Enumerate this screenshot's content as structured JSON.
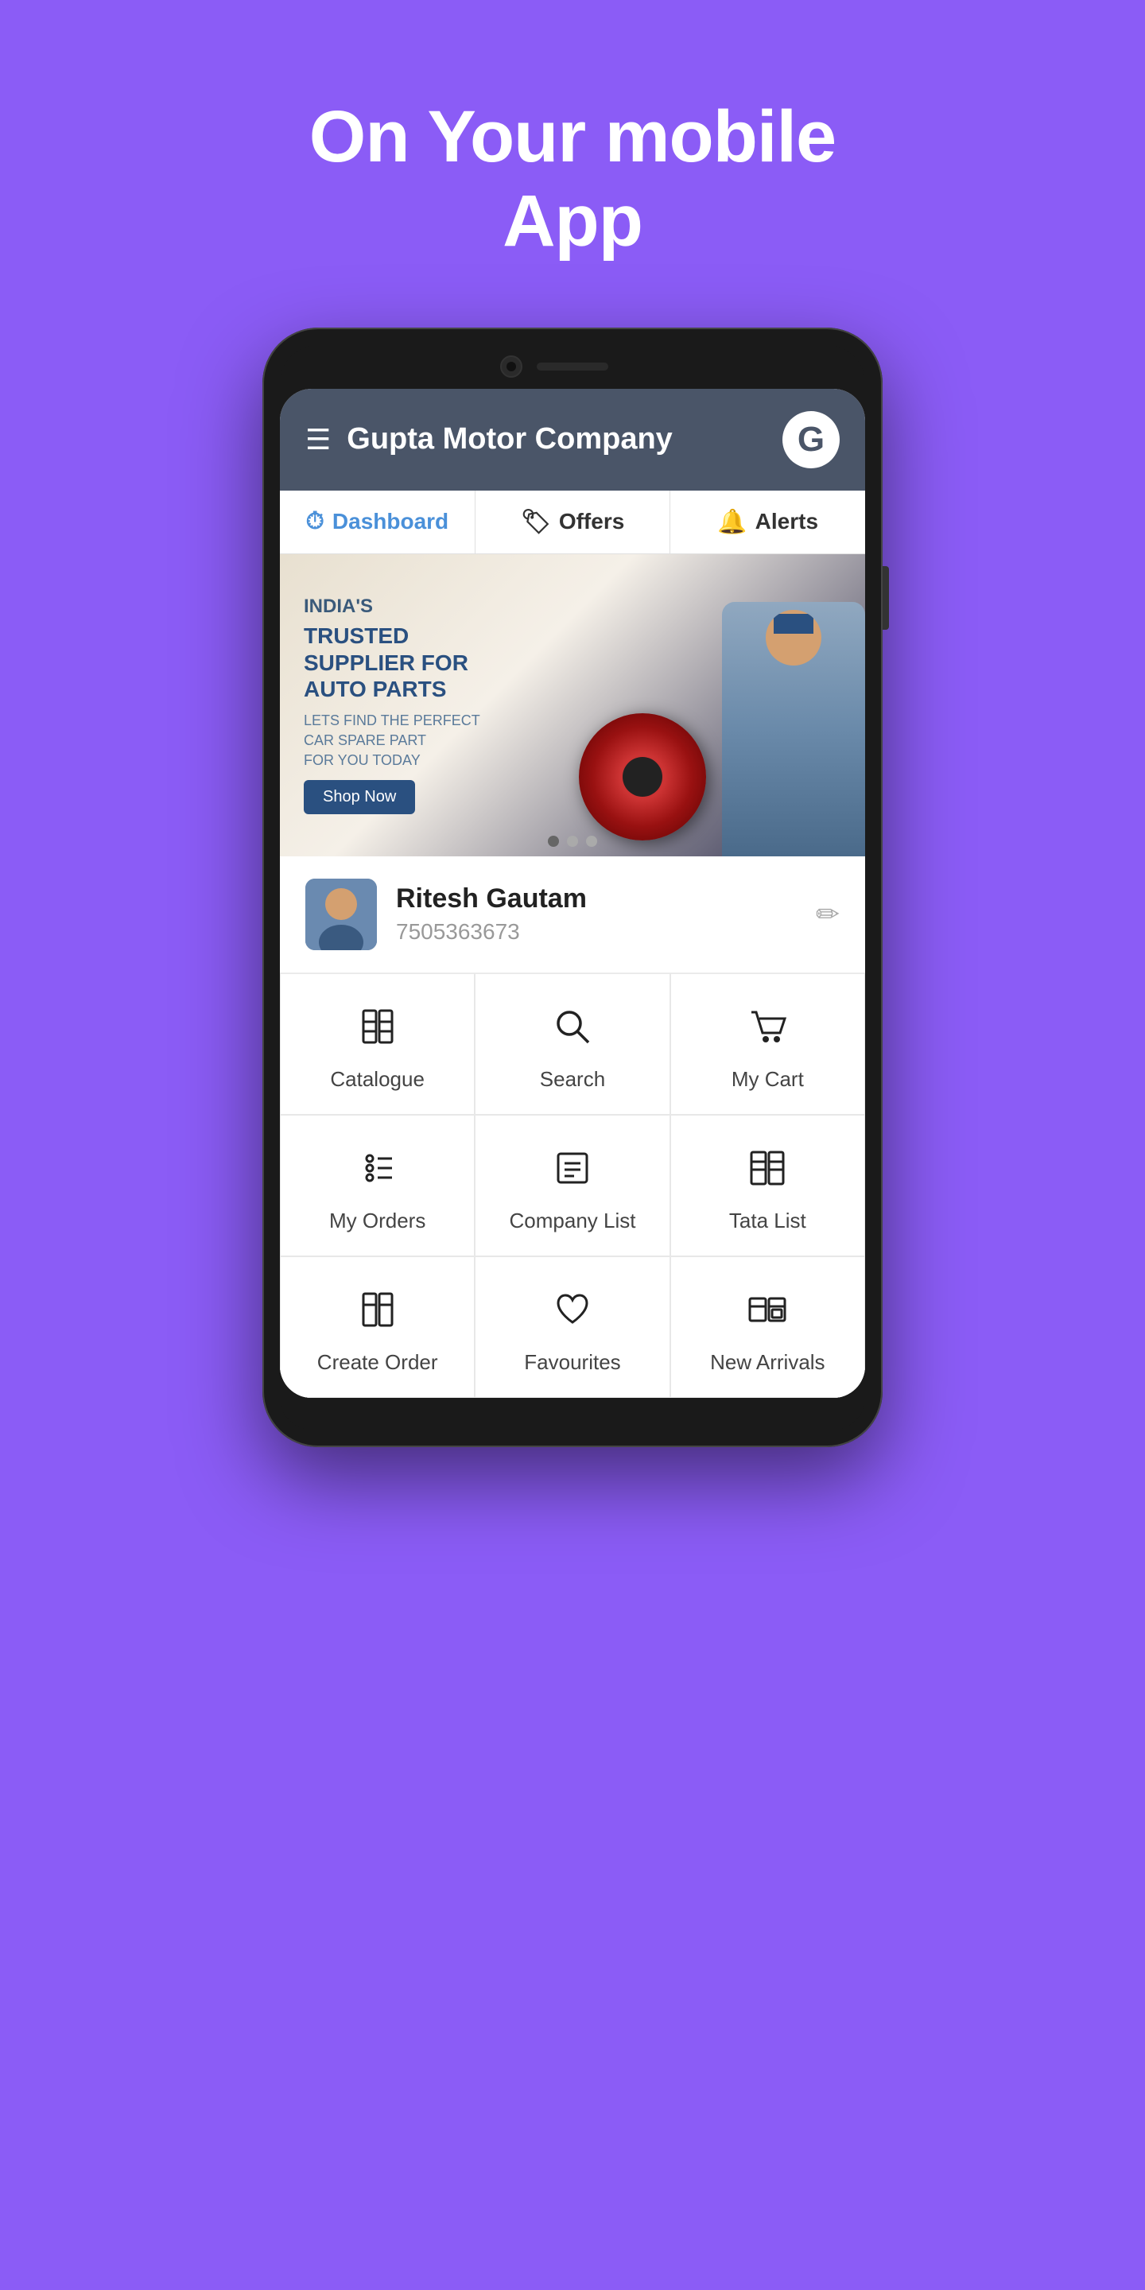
{
  "hero": {
    "title_line1": "On Your mobile",
    "title_line2": "App"
  },
  "app": {
    "header": {
      "title": "Gupta Motor Company",
      "logo_letter": "G"
    },
    "nav_tabs": [
      {
        "id": "dashboard",
        "label": "Dashboard",
        "active": true
      },
      {
        "id": "offers",
        "label": "Offers",
        "active": false
      },
      {
        "id": "alerts",
        "label": "Alerts",
        "active": false
      }
    ],
    "banner": {
      "tag": "INDIA'S",
      "headline": "TRUSTED\nSUPPLIER FOR\nAUTO PARTS",
      "sub": "LETS FIND THE PERFECT\nCAR SPARE PART\nFOR YOU TODAY",
      "cta": "Shop Now",
      "dots": [
        {
          "active": true
        },
        {
          "active": false
        },
        {
          "active": false
        }
      ]
    },
    "user": {
      "name": "Ritesh Gautam",
      "phone": "7505363673"
    },
    "menu_items": [
      {
        "id": "catalogue",
        "label": "Catalogue",
        "icon": "catalogue"
      },
      {
        "id": "search",
        "label": "Search",
        "icon": "search"
      },
      {
        "id": "my-cart",
        "label": "My Cart",
        "icon": "cart"
      },
      {
        "id": "my-orders",
        "label": "My Orders",
        "icon": "orders"
      },
      {
        "id": "company-list",
        "label": "Company List",
        "icon": "company-list"
      },
      {
        "id": "tata-list",
        "label": "Tata List",
        "icon": "tata-list"
      },
      {
        "id": "create-order",
        "label": "Create Order",
        "icon": "create-order"
      },
      {
        "id": "favourites",
        "label": "Favourites",
        "icon": "favourites"
      },
      {
        "id": "new-arrivals",
        "label": "New Arrivals",
        "icon": "new-arrivals"
      }
    ]
  }
}
